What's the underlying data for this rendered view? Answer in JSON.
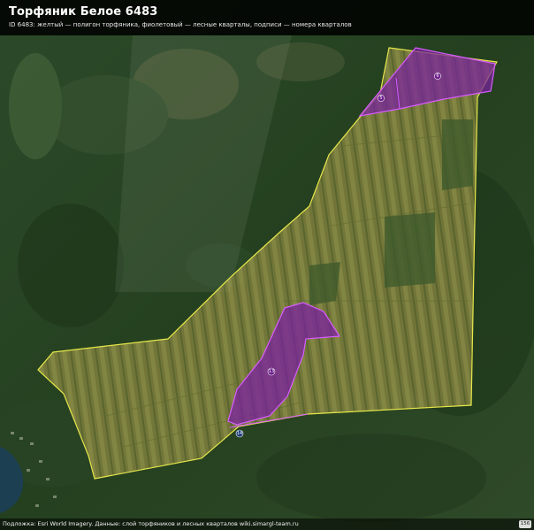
{
  "header": {
    "title": "Торфяник Белое 6483",
    "subtitle": "ID 6483: желтый — полигон торфяника, фиолетовый — лесные кварталы, подписи — номера кварталов"
  },
  "footer": {
    "attribution": "Подложка: Esri World Imagery. Данные: слой торфяников и лесных кварталов wiki.simargl-team.ru",
    "badge": "156"
  },
  "colors": {
    "peat_polygon_stroke": "#e6e64a",
    "peat_polygon_fill": "#c8c83c",
    "forest_quarter_stroke": "#d85cff",
    "forest_quarter_fill": "#7b1fa2",
    "forest_dark": "#1f3a1e"
  },
  "quarters": [
    {
      "id": "q-north-east",
      "label": "6"
    },
    {
      "id": "q-north-west",
      "label": "5"
    },
    {
      "id": "q-center",
      "label": "13"
    },
    {
      "id": "q-south",
      "label": "14"
    }
  ]
}
